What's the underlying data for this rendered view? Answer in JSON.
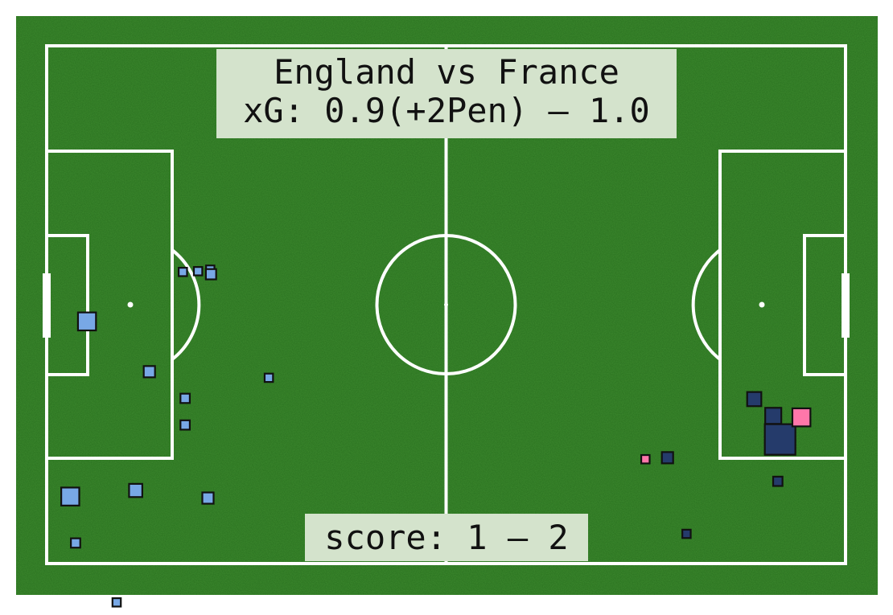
{
  "chart_data": {
    "type": "scatter",
    "title": "England vs France",
    "subtitle": "xG: 0.9(+2Pen) – 1.0",
    "footer": "score: 1 – 2",
    "pitch": {
      "length": 105,
      "width": 68,
      "grid": false
    },
    "colors": {
      "pitch": "#3e8a2f",
      "lines": "#ffffff",
      "label_box": "#d4e3cc",
      "england": "#78a8e6",
      "france": "#253b6b",
      "goal": "#ff77aa",
      "marker_edge": "#111111"
    },
    "series": [
      {
        "team": "England",
        "shots": [
          {
            "x": 17.9,
            "y": 38.3,
            "xg": 0.02
          },
          {
            "x": 19.9,
            "y": 38.4,
            "xg": 0.02
          },
          {
            "x": 21.5,
            "y": 38.6,
            "xg": 0.02
          },
          {
            "x": 21.6,
            "y": 38.0,
            "xg": 0.04
          },
          {
            "x": 5.3,
            "y": 31.8,
            "xg": 0.12
          },
          {
            "x": 13.5,
            "y": 25.2,
            "xg": 0.05
          },
          {
            "x": 29.2,
            "y": 24.4,
            "xg": 0.02
          },
          {
            "x": 18.2,
            "y": 21.7,
            "xg": 0.03
          },
          {
            "x": 18.2,
            "y": 18.2,
            "xg": 0.03
          },
          {
            "x": 3.1,
            "y": 8.8,
            "xg": 0.12
          },
          {
            "x": 11.7,
            "y": 9.6,
            "xg": 0.07
          },
          {
            "x": 21.2,
            "y": 8.6,
            "xg": 0.05
          },
          {
            "x": 3.8,
            "y": 2.7,
            "xg": 0.03
          },
          {
            "x": 9.2,
            "y": -5.1,
            "xg": 0.02
          }
        ]
      },
      {
        "team": "France",
        "shots": [
          {
            "x": 93.0,
            "y": 21.6,
            "xg": 0.08
          },
          {
            "x": 95.5,
            "y": 19.4,
            "xg": 0.1
          },
          {
            "x": 96.4,
            "y": 16.3,
            "xg": 0.25
          },
          {
            "x": 81.6,
            "y": 13.9,
            "xg": 0.05
          },
          {
            "x": 96.1,
            "y": 10.8,
            "xg": 0.03
          },
          {
            "x": 84.1,
            "y": 3.9,
            "xg": 0.02
          }
        ]
      },
      {
        "team": "Goal",
        "shots": [
          {
            "x": 99.2,
            "y": 19.2,
            "xg": 0.12
          },
          {
            "x": 78.7,
            "y": 13.7,
            "xg": 0.02
          }
        ]
      }
    ]
  }
}
